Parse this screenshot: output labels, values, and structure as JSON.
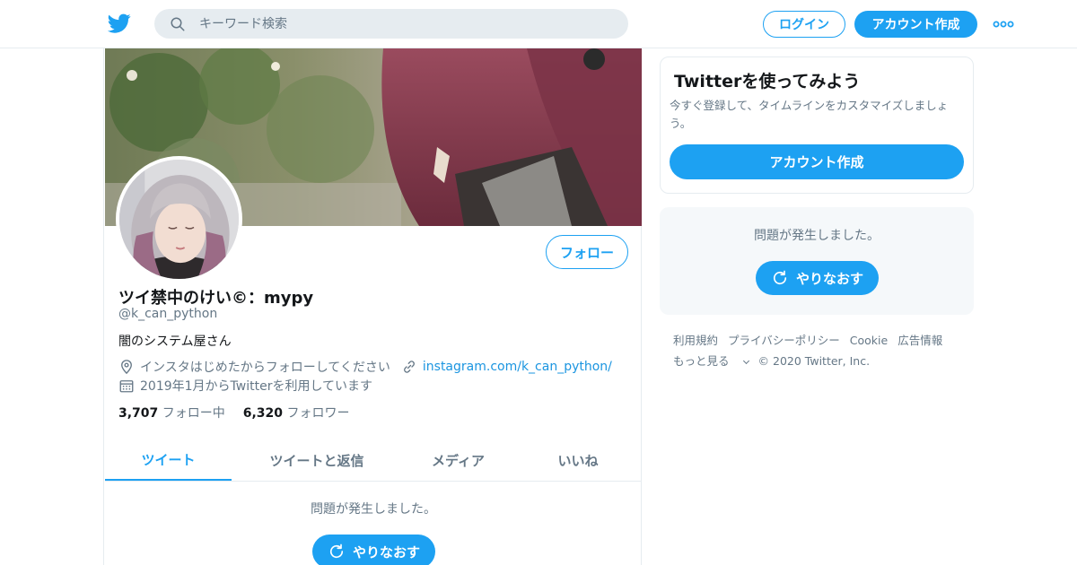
{
  "header": {
    "search_placeholder": "キーワード検索",
    "login_label": "ログイン",
    "signup_label": "アカウント作成"
  },
  "profile": {
    "display_name": "ツイ禁中のけい©︎：mypy",
    "handle": "@k_can_python",
    "bio": "闇のシステム屋さん",
    "location": "インスタはじめたからフォローしてください",
    "url": "instagram.com/k_can_python/",
    "joined": "2019年1月からTwitterを利用しています",
    "following_count": "3,707",
    "following_label": "フォロー中",
    "followers_count": "6,320",
    "followers_label": "フォロワー",
    "follow_button": "フォロー"
  },
  "tabs": [
    {
      "label": "ツイート",
      "active": true
    },
    {
      "label": "ツイートと返信",
      "active": false
    },
    {
      "label": "メディア",
      "active": false
    },
    {
      "label": "いいね",
      "active": false
    }
  ],
  "timeline": {
    "error_text": "問題が発生しました。",
    "retry_label": "やりなおす"
  },
  "sidebar": {
    "signup_card": {
      "title": "Twitterを使ってみよう",
      "description": "今すぐ登録して、タイムラインをカスタマイズしましょう。",
      "button": "アカウント作成"
    },
    "error_card": {
      "error_text": "問題が発生しました。",
      "retry_label": "やりなおす"
    },
    "footer": {
      "links": [
        "利用規約",
        "プライバシーポリシー",
        "Cookie",
        "広告情報"
      ],
      "more": "もっと見る",
      "copyright": "© 2020 Twitter, Inc."
    }
  },
  "colors": {
    "brand": "#1da1f2",
    "muted": "#657786",
    "text": "#14171a",
    "border": "#e6ecf0"
  },
  "icons": [
    "twitter-bird-icon",
    "search-icon",
    "more-icon",
    "location-icon",
    "link-icon",
    "calendar-icon",
    "refresh-icon",
    "chevron-down-icon"
  ]
}
